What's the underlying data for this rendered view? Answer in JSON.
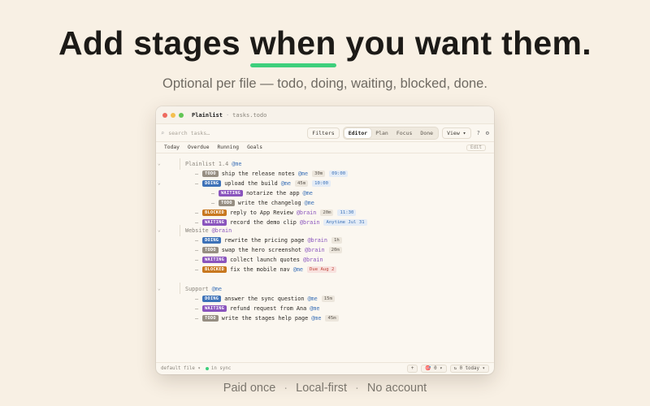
{
  "hero": {
    "title_before": "Add stages ",
    "title_highlight": "when",
    "title_after": " you want them.",
    "subtitle": "Optional per file — todo, doing, waiting, blocked, done."
  },
  "window": {
    "app_name": "Plainlist",
    "separator": "·",
    "file_name": "tasks.todo"
  },
  "toolbar": {
    "search_icon": "⌕",
    "search_placeholder": "search tasks…",
    "filters_label": "Filters",
    "tabs": [
      "Editor",
      "Plan",
      "Focus",
      "Done"
    ],
    "active_tab": "Editor",
    "view_label": "View ▾",
    "help_label": "?",
    "settings_icon": "⚙"
  },
  "filterbar": {
    "items": [
      "Today",
      "Overdue",
      "Running",
      "Goals"
    ],
    "edit_label": "Edit"
  },
  "projects": [
    {
      "name": "Plainlist 1.4",
      "mention": "@me"
    },
    {
      "name": "Website",
      "mention": "@brain"
    },
    {
      "name": "Support",
      "mention": "@me"
    }
  ],
  "tasks": [
    {
      "badge": "TODO",
      "text": "ship the release notes",
      "mention": "@me",
      "chips": [
        {
          "t": "30m",
          "k": "dur"
        },
        {
          "t": "09:00",
          "k": "time"
        }
      ]
    },
    {
      "badge": "DOING",
      "text": "upload the build",
      "mention": "@me",
      "chips": [
        {
          "t": "45m",
          "k": "dur"
        },
        {
          "t": "10:00",
          "k": "time"
        }
      ]
    },
    {
      "badge": "WAITING",
      "text": "notarize the app",
      "mention": "@me",
      "chips": []
    },
    {
      "badge": "TODO",
      "text": "write the changelog",
      "mention": "@me",
      "chips": []
    },
    {
      "badge": "BLOCKED",
      "text": "reply to App Review",
      "mention": "@brain",
      "chips": [
        {
          "t": "20m",
          "k": "dur"
        },
        {
          "t": "11:30",
          "k": "time"
        }
      ]
    },
    {
      "badge": "WAITING",
      "text": "record the demo clip",
      "mention": "@brain",
      "chips": [
        {
          "t": "Anytime Jul 31",
          "k": "date"
        }
      ]
    },
    {
      "badge": "DOING",
      "text": "rewrite the pricing page",
      "mention": "@brain",
      "chips": [
        {
          "t": "1h",
          "k": "dur"
        }
      ]
    },
    {
      "badge": "TODO",
      "text": "swap the hero screenshot",
      "mention": "@brain",
      "chips": [
        {
          "t": "20m",
          "k": "dur"
        }
      ]
    },
    {
      "badge": "WAITING",
      "text": "collect launch quotes",
      "mention": "@brain",
      "chips": []
    },
    {
      "badge": "BLOCKED",
      "text": "fix the mobile nav",
      "mention": "@me",
      "chips": [
        {
          "t": "Due Aug 2",
          "k": "due"
        }
      ]
    },
    {
      "badge": "DOING",
      "text": "answer the sync question",
      "mention": "@me",
      "chips": [
        {
          "t": "15m",
          "k": "dur"
        }
      ]
    },
    {
      "badge": "WAITING",
      "text": "refund request from Ana",
      "mention": "@me",
      "chips": []
    },
    {
      "badge": "TODO",
      "text": "write the stages help page",
      "mention": "@me",
      "chips": [
        {
          "t": "45m",
          "k": "dur"
        }
      ]
    }
  ],
  "statusbar": {
    "file_label": "default file ▾",
    "sync_label": "in sync",
    "add_label": "+",
    "pomodoro_label": "🎯 0 ▾",
    "today_label": "↻ 0 today ▾"
  },
  "footer": {
    "items": [
      "Paid once",
      "Local-first",
      "No account"
    ],
    "separator": "·"
  },
  "colors": {
    "background": "#f8f0e4",
    "accent_underline": "#3dcf7c",
    "todo": "#968e82",
    "doing": "#3d72b8",
    "waiting": "#8a54bd",
    "blocked": "#c8781f"
  }
}
